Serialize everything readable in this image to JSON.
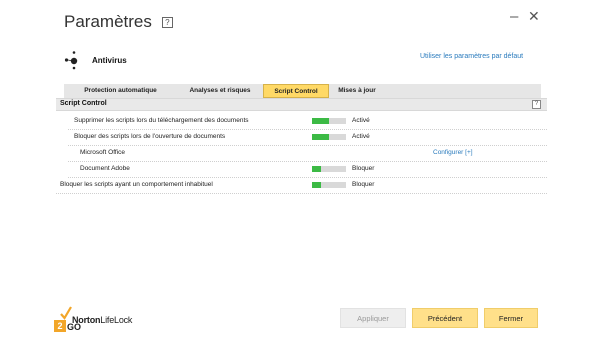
{
  "window": {
    "title": "Paramètres",
    "title_help": "?",
    "minimize": "–",
    "close": "✕"
  },
  "product": {
    "name": "Antivirus",
    "icon": "antivirus-icon",
    "defaults_link": "Utiliser les paramètres par défaut"
  },
  "tabs": [
    {
      "label": "Protection automatique",
      "active": false
    },
    {
      "label": "Analyses et risques",
      "active": false
    },
    {
      "label": "Script Control",
      "active": true
    },
    {
      "label": "Mises à jour",
      "active": false
    }
  ],
  "section": {
    "title": "Script Control",
    "help": "?"
  },
  "rows": [
    {
      "label": "Supprimer les scripts lors du téléchargement des documents",
      "toggle_level": 0.5,
      "state": "Activé"
    },
    {
      "label": "Bloquer des scripts lors de l'ouverture de documents",
      "toggle_level": 0.5,
      "state": "Activé"
    },
    {
      "label": "Microsoft Office",
      "link": "Configurer [+]"
    },
    {
      "label": "Document Adobe",
      "toggle_level": 0.25,
      "state": "Bloquer"
    },
    {
      "label": "Bloquer les scripts ayant un comportement inhabituel",
      "toggle_level": 0.25,
      "state": "Bloquer"
    }
  ],
  "logo": {
    "brand_a": "Norton",
    "brand_b": "LifeLock",
    "mark_num": "2",
    "mark_go": "GO"
  },
  "buttons": {
    "apply": "Appliquer",
    "previous": "Précédent",
    "close": "Fermer"
  },
  "colors": {
    "accent_tab": "#ffd966",
    "toggle_on": "#3cba45",
    "link": "#2a7bbd"
  }
}
